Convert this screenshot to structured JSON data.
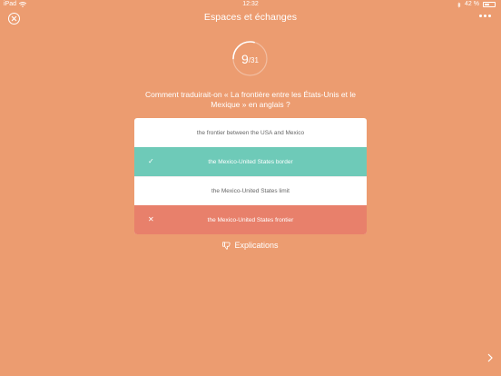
{
  "status_bar": {
    "device": "iPad",
    "time": "12:32",
    "battery_percent": "42 %",
    "battery_level": 0.42
  },
  "header": {
    "title": "Espaces et échanges"
  },
  "progress": {
    "current": "9",
    "total": "/31",
    "fraction": 0.29
  },
  "question": {
    "text": "Comment traduirait-on « La frontière entre les États-Unis et le Mexique » en anglais ?"
  },
  "answers": [
    {
      "label": "the frontier between the USA and Mexico",
      "state": "neutral",
      "mark": ""
    },
    {
      "label": "the Mexico-United States border",
      "state": "correct",
      "mark": "✓"
    },
    {
      "label": "the Mexico-United States limit",
      "state": "neutral",
      "mark": ""
    },
    {
      "label": "the Mexico-United States frontier",
      "state": "wrong",
      "mark": "✕"
    }
  ],
  "explanations": {
    "label": "Explications"
  },
  "colors": {
    "background": "#EC9C70",
    "correct": "#6ECAB8",
    "wrong": "#E8806B",
    "answer_text": "#666666"
  },
  "icons": {
    "close": "close-circle-icon",
    "more": "more-dots-icon",
    "explanations": "thumbs-down-icon",
    "next": "chevron-right-icon"
  }
}
